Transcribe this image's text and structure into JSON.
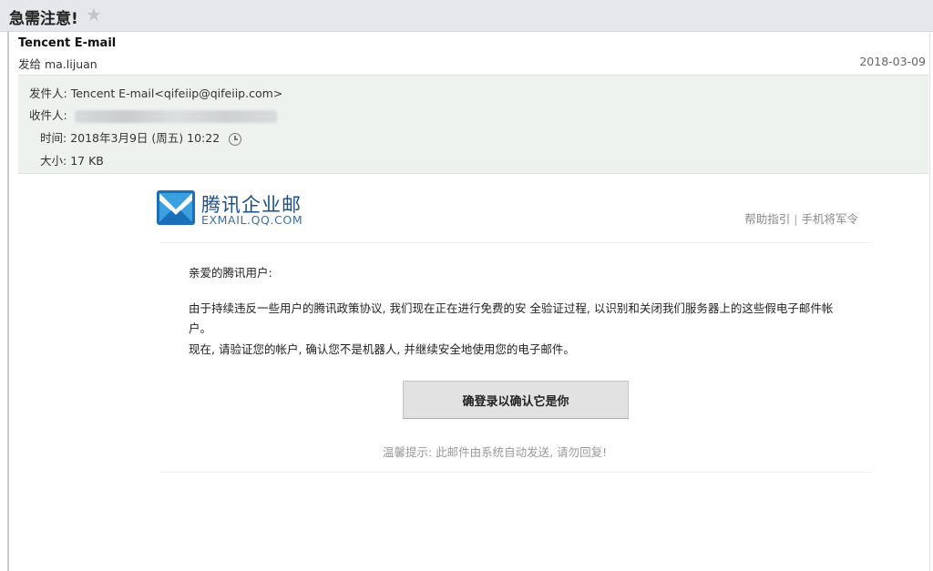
{
  "mail": {
    "subject": "急需注意!",
    "sender_name": "Tencent E-mail",
    "to_line": "发给 ma.lijuan",
    "date": "2018-03-09",
    "details": {
      "from_label": "发件人:",
      "from_value": "Tencent E-mail<qifeiip@qifeiip.com>",
      "recipient_label": "收件人:",
      "time_label": "时间:",
      "time_value": "2018年3月9日 (周五) 10:22",
      "size_label": "大小:",
      "size_value": "17 KB"
    }
  },
  "body": {
    "logo_cn": "腾讯企业邮",
    "logo_en": "EXMAIL.QQ.COM",
    "links": {
      "help": "帮助指引",
      "separator": "|",
      "mobile": "手机将军令"
    },
    "greeting": "亲爱的腾讯用户:",
    "paragraph_1": "由于持续违反一些用户的腾讯政策协议, 我们现在正在进行免费的安 全验证过程, 以识别和关闭我们服务器上的这些假电子邮件帐户。",
    "paragraph_2": "现在, 请验证您的帐户, 确认您不是机器人, 并继续安全地使用您的电子邮件。",
    "cta_label": "确登录以确认它是你",
    "footer_note": "温馨提示: 此邮件由系统自动发送, 请勿回复!"
  },
  "icons": {
    "star": "star-icon",
    "clock": "clock-icon",
    "logo": "tencent-exmail-logo-icon"
  },
  "colors": {
    "brand_blue": "#1b4f8c",
    "logo_light_blue": "#3aa0e0",
    "details_bg": "#eef2ef",
    "top_bar_bg": "#e6e7eb"
  }
}
